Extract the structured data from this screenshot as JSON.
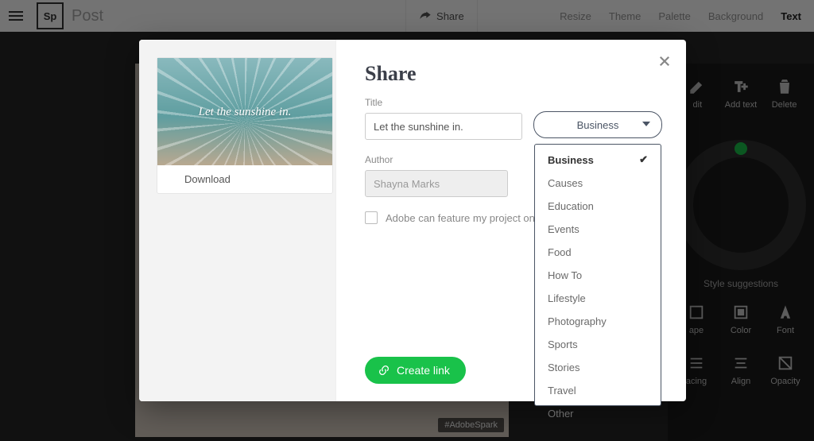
{
  "app": {
    "logo": "Sp",
    "product": "Post"
  },
  "topbar": {
    "share": "Share",
    "menu": {
      "resize": "Resize",
      "theme": "Theme",
      "palette": "Palette",
      "background": "Background",
      "text": "Text"
    }
  },
  "sidebar": {
    "row1": {
      "edit": "dit",
      "addtext": "Add text",
      "delete": "Delete"
    },
    "suggestions": "Style suggestions",
    "row2": {
      "shape": "ape",
      "color": "Color",
      "font": "Font"
    },
    "row3": {
      "spacing": "acing",
      "align": "Align",
      "opacity": "Opacity"
    }
  },
  "canvas": {
    "tag": "#AdobeSpark"
  },
  "modal": {
    "header": "Share",
    "title_label": "Title",
    "title_value": "Let the sunshine in.",
    "author_label": "Author",
    "author_value": "Shayna Marks",
    "feature_label": "Adobe can feature my project on their website",
    "create_link": "Create link",
    "download": "Download",
    "thumb_text": "Let the sunshine in.",
    "dropdown": {
      "selected": "Business",
      "options": [
        "Business",
        "Causes",
        "Education",
        "Events",
        "Food",
        "How To",
        "Lifestyle",
        "Photography",
        "Sports",
        "Stories",
        "Travel",
        "Other"
      ]
    }
  }
}
